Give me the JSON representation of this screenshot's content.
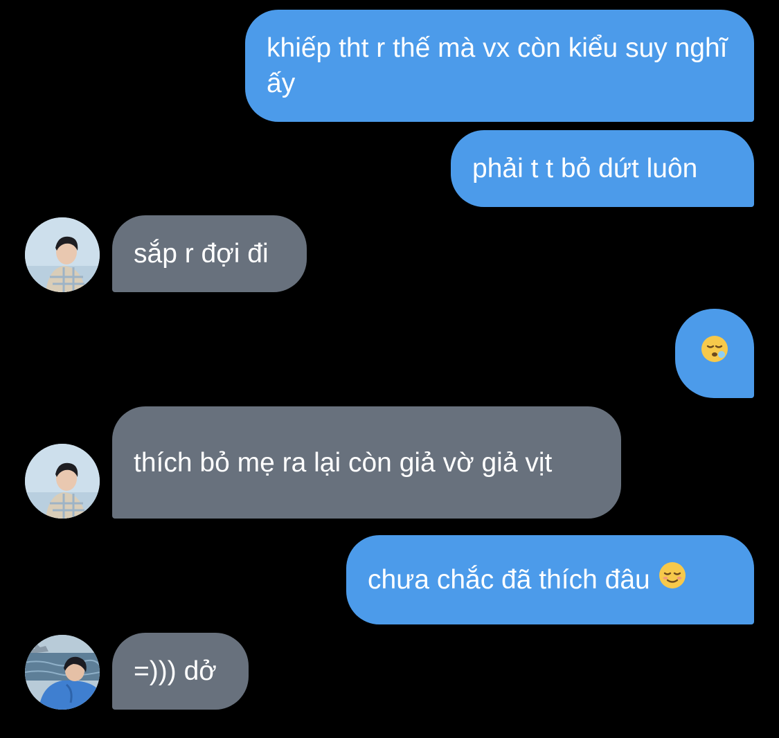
{
  "messages": [
    {
      "id": "m1",
      "direction": "outgoing",
      "text": "khiếp tht r thế mà vx còn kiểu suy nghĩ ấy"
    },
    {
      "id": "m2",
      "direction": "outgoing",
      "text": "phải t t bỏ dứt luôn"
    },
    {
      "id": "m3",
      "direction": "incoming",
      "text": "sắp r đợi đi"
    },
    {
      "id": "m4",
      "direction": "outgoing",
      "text": "",
      "emoji": "sleepy-face-emoji"
    },
    {
      "id": "m5",
      "direction": "incoming",
      "text": "thích bỏ mẹ ra lại còn giả vờ giả vịt"
    },
    {
      "id": "m6",
      "direction": "outgoing",
      "text": "chưa chắc đã thích đâu",
      "emoji": "relieved-face-emoji"
    },
    {
      "id": "m7",
      "direction": "incoming",
      "text": "=))) dở"
    }
  ],
  "colors": {
    "background": "#000000",
    "outgoing_bubble": "#4c9bea",
    "incoming_bubble": "#68717d",
    "text": "#ffffff"
  }
}
